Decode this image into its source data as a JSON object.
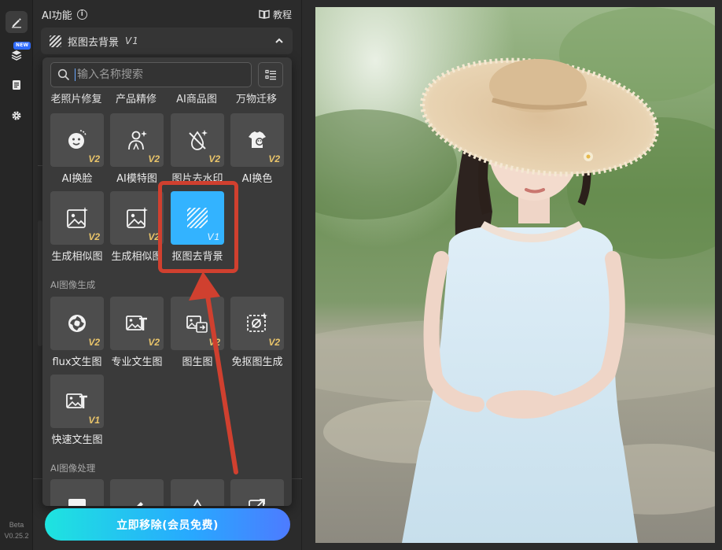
{
  "rail": {
    "new_badge": "NEW",
    "version_label": "Beta",
    "version_number": "V0.25.2"
  },
  "panel": {
    "title": "AI功能",
    "info_glyph": "i",
    "tutorial_label": "教程"
  },
  "section": {
    "title": "抠图去背景",
    "version": "V1"
  },
  "search": {
    "placeholder": "输入名称搜索",
    "value": ""
  },
  "category_tabs": [
    "老照片修复",
    "产品精修",
    "AI商品图",
    "万物迁移"
  ],
  "groups": {
    "ai_image_generation": "AI图像生成",
    "ai_image_processing": "AI图像处理"
  },
  "tools": [
    {
      "label": "AI换脸",
      "version": "V2",
      "icon": "face-swap-icon"
    },
    {
      "label": "AI模特图",
      "version": "V2",
      "icon": "model-icon"
    },
    {
      "label": "图片去水印",
      "version": "V2",
      "icon": "watermark-remove-icon"
    },
    {
      "label": "AI换色",
      "version": "V2",
      "icon": "color-change-icon"
    },
    {
      "label": "生成相似图",
      "version": "V2",
      "icon": "similar-image-icon"
    },
    {
      "label": "生成相似图",
      "version": "V2",
      "icon": "similar-image-icon"
    },
    {
      "label": "抠图去背景",
      "version": "V1",
      "icon": "background-remove-icon",
      "selected": true
    },
    {
      "label": "flux文生图",
      "version": "V2",
      "icon": "flux-icon"
    },
    {
      "label": "专业文生图",
      "version": "V2",
      "icon": "text-to-image-icon"
    },
    {
      "label": "图生图",
      "version": "V2",
      "icon": "image-to-image-icon"
    },
    {
      "label": "免抠图生成",
      "version": "V2",
      "icon": "no-cutout-icon"
    },
    {
      "label": "快速文生图",
      "version": "V1",
      "icon": "text-to-image-icon"
    }
  ],
  "cta_label": "立即移除(会员免费)",
  "colors": {
    "accent_selected": "#33b3ff",
    "version_tag": "#e9c46a",
    "annotation_red": "#d0402f",
    "cta_start": "#1ee4df",
    "cta_end": "#4d7bff"
  }
}
